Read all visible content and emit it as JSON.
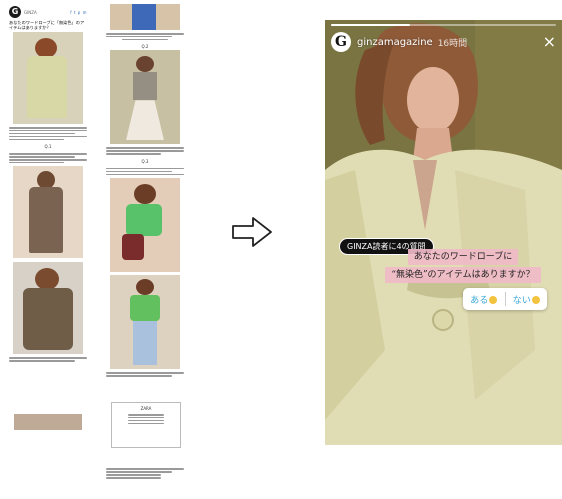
{
  "article_left": {
    "logo": "G",
    "header_text": "GINZA",
    "share_icons": "f t p m",
    "heading": "あなたのワードローブに「無染色」のアイテムはありますか？",
    "section_label": "Q.1"
  },
  "article_right": {
    "section_label_1": "Q.2",
    "section_label_2": "Q.3",
    "footer_box_label": "ZARA"
  },
  "arrow": {
    "icon": "right-arrow-outline"
  },
  "story": {
    "avatar_letter": "G",
    "username": "ginzamagazine",
    "timestamp": "16時間",
    "close_glyph": "×",
    "question_tag": "GINZA読者に4の質問",
    "question_line_1": "あなたのワードローブに",
    "question_line_2": "“無染色”のアイテムはありますか？",
    "poll_option_yes": "ある",
    "poll_option_no": "ない",
    "progress_fraction": 0.35,
    "colors": {
      "bg": "#7c7440",
      "highlight": "#f0bac8",
      "poll_text": "#3aa7d8"
    }
  }
}
